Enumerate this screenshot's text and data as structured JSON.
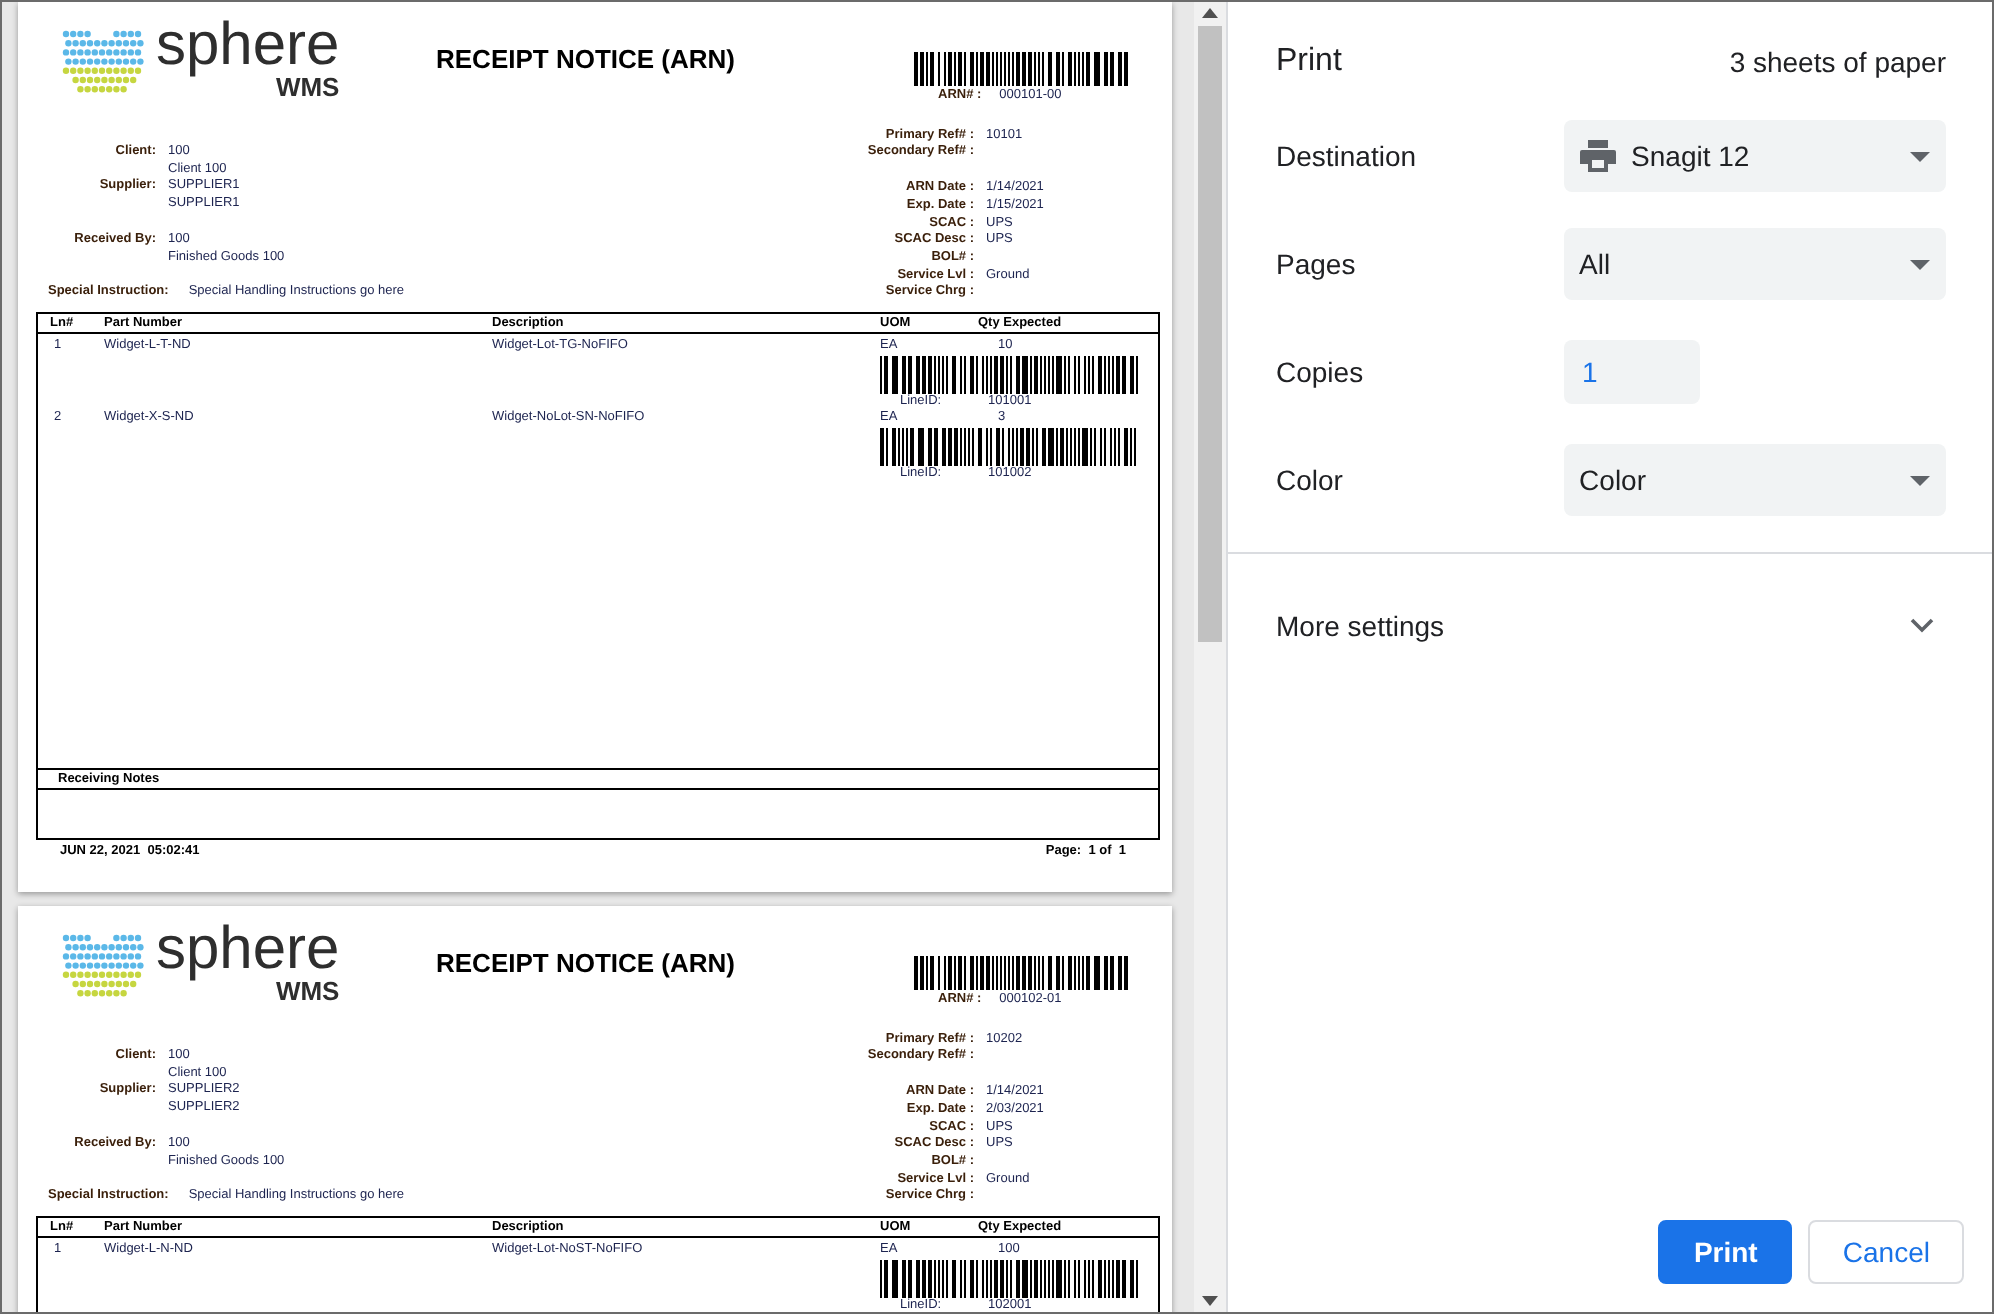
{
  "preview": {
    "pages": [
      {
        "logo": {
          "word": "sphere",
          "sub": "WMS"
        },
        "title": "RECEIPT NOTICE (ARN)",
        "arn": {
          "label": "ARN# :",
          "value": "000101-00"
        },
        "left_groups": [
          [
            {
              "label": "Client:",
              "lines": [
                "100",
                "Client 100"
              ]
            },
            {
              "label": "Supplier:",
              "lines": [
                "SUPPLIER1",
                "SUPPLIER1"
              ]
            }
          ],
          [
            {
              "label": "Received By:",
              "lines": [
                "100",
                "Finished Goods 100"
              ]
            }
          ]
        ],
        "special_instruction": {
          "label": "Special Instruction:",
          "value": "Special Handling Instructions go here"
        },
        "right_groups": [
          [
            {
              "label": "Primary Ref# :",
              "value": "10101"
            },
            {
              "label": "Secondary Ref# :"
            }
          ],
          [
            {
              "label": "ARN Date :",
              "value": "1/14/2021"
            },
            {
              "label": "Exp. Date :",
              "value": "1/15/2021"
            },
            {
              "label": "SCAC :",
              "value": "UPS"
            },
            {
              "label": "SCAC Desc :",
              "value": "UPS"
            },
            {
              "label": "BOL# :"
            },
            {
              "label": "Service Lvl :",
              "value": "Ground"
            },
            {
              "label": "Service Chrg :"
            }
          ]
        ],
        "table": {
          "columns": [
            "Ln#",
            "Part Number",
            "Description",
            "UOM",
            "Qty Expected"
          ],
          "rows": [
            {
              "ln": "1",
              "part_number": "Widget-L-T-ND",
              "description": "Widget-Lot-TG-NoFIFO",
              "uom": "EA",
              "qty_expected": "10",
              "line_id_label": "LineID:",
              "line_id": "101001"
            },
            {
              "ln": "2",
              "part_number": "Widget-X-S-ND",
              "description": "Widget-NoLot-SN-NoFIFO",
              "uom": "EA",
              "qty_expected": "3",
              "line_id_label": "LineID:",
              "line_id": "101002"
            }
          ]
        },
        "receiving_notes": "Receiving Notes",
        "footer": {
          "printed": "JUN 22, 2021  05:02:41",
          "page": "Page:  1 of  1"
        }
      },
      {
        "logo": {
          "word": "sphere",
          "sub": "WMS"
        },
        "title": "RECEIPT NOTICE (ARN)",
        "arn": {
          "label": "ARN# :",
          "value": "000102-01"
        },
        "left_groups": [
          [
            {
              "label": "Client:",
              "lines": [
                "100",
                "Client 100"
              ]
            },
            {
              "label": "Supplier:",
              "lines": [
                "SUPPLIER2",
                "SUPPLIER2"
              ]
            }
          ],
          [
            {
              "label": "Received By:",
              "lines": [
                "100",
                "Finished Goods 100"
              ]
            }
          ]
        ],
        "special_instruction": {
          "label": "Special Instruction:",
          "value": "Special Handling Instructions go here"
        },
        "right_groups": [
          [
            {
              "label": "Primary Ref# :",
              "value": "10202"
            },
            {
              "label": "Secondary Ref# :"
            }
          ],
          [
            {
              "label": "ARN Date :",
              "value": "1/14/2021"
            },
            {
              "label": "Exp. Date :",
              "value": "2/03/2021"
            },
            {
              "label": "SCAC :",
              "value": "UPS"
            },
            {
              "label": "SCAC Desc :",
              "value": "UPS"
            },
            {
              "label": "BOL# :"
            },
            {
              "label": "Service Lvl :",
              "value": "Ground"
            },
            {
              "label": "Service Chrg :"
            }
          ]
        ],
        "table": {
          "columns": [
            "Ln#",
            "Part Number",
            "Description",
            "UOM",
            "Qty Expected"
          ],
          "rows": [
            {
              "ln": "1",
              "part_number": "Widget-L-N-ND",
              "description": "Widget-Lot-NoST-NoFIFO",
              "uom": "EA",
              "qty_expected": "100",
              "line_id_label": "LineID:",
              "line_id": "102001"
            }
          ]
        }
      }
    ]
  },
  "print_panel": {
    "title": "Print",
    "sheets": "3 sheets of paper",
    "settings": [
      {
        "kind": "destination",
        "label": "Destination",
        "value": "Snagit 12"
      },
      {
        "kind": "select",
        "label": "Pages",
        "value": "All"
      },
      {
        "kind": "number",
        "label": "Copies",
        "value": "1"
      },
      {
        "kind": "select",
        "label": "Color",
        "value": "Color"
      }
    ],
    "more_settings": {
      "label": "More settings",
      "expanded": false
    },
    "buttons": [
      {
        "label": "Print",
        "primary": true
      },
      {
        "label": "Cancel",
        "primary": false
      }
    ]
  }
}
